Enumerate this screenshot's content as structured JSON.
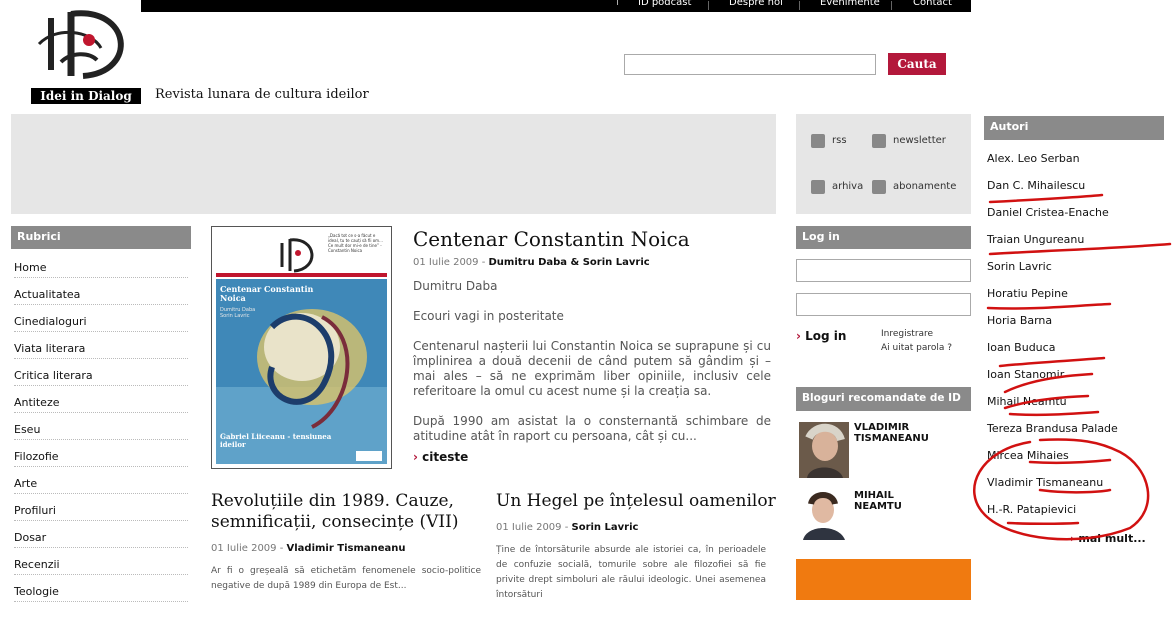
{
  "topnav": [
    "ID podcast",
    "Despre noi",
    "Evenimente",
    "Contact"
  ],
  "logo_text": "Idei in Dialog",
  "tagline": "Revista lunara de cultura ideilor",
  "search": {
    "button": "Cauta"
  },
  "rubrici": {
    "title": "Rubrici",
    "items": [
      "Home",
      "Actualitatea",
      "Cinedialoguri",
      "Viata literara",
      "Critica literara",
      "Antiteze",
      "Eseu",
      "Filozofie",
      "Arte",
      "Profiluri",
      "Dosar",
      "Recenzii",
      "Teologie"
    ]
  },
  "cover": {
    "quote": "„Dacă tot ce s-a făcut e ideal, tu te cauți să fii om... Ce mult dor mi-e de tine” - Constantin Noica",
    "title": "Centenar Constantin Noica",
    "authors": "Dumitru Daba\nSorin Lavric",
    "bottom": "Gabriel Liiceanu - tensiunea ideilor"
  },
  "main_article": {
    "title": "Centenar Constantin Noica",
    "date": "01 Iulie 2009 - ",
    "author": "Dumitru Daba & Sorin Lavric",
    "p1": "Dumitru Daba",
    "p2": "Ecouri vagi in posteritate",
    "p3": "Centenarul nașterii lui Constantin Noica se suprapune și cu împlinirea a două decenii de când putem să gândim și – mai ales – să ne exprimăm liber opiniile, inclusiv cele referitoare la omul cu acest nume și la creația sa.",
    "p4": "După 1990 am asistat la o consternantă schimbare de atitudine atât în raport cu persoana, cât și cu...",
    "more": "citeste"
  },
  "article2": {
    "title": "Revoluțiile din 1989. Cauze, semnificații, consecințe (VII)",
    "date": "01 Iulie 2009 - ",
    "author": "Vladimir Tismaneanu",
    "text": "Ar fi o greșeală să etichetăm fenomenele socio-politice negative de după 1989 din Europa de Est..."
  },
  "article3": {
    "title": "Un Hegel pe înțelesul oamenilor",
    "date": "01 Iulie 2009 - ",
    "author": "Sorin Lavric",
    "text": "Ține de întorsăturile absurde ale istoriei ca, în perioadele de confuzie socială, tomurile sobre ale filozofiei să fie privite drept simboluri ale răului ideologic. Unei asemenea întorsături"
  },
  "links": {
    "rss": "rss",
    "newsletter": "newsletter",
    "arhiva": "arhiva",
    "abonamente": "abonamente"
  },
  "login": {
    "title": "Log in",
    "button": "Log in",
    "register": "Inregistrare",
    "forgot": "Ai uitat parola ?"
  },
  "blogs": {
    "title": "Bloguri recomandate de ID",
    "items": [
      {
        "name": "VLADIMIR\nTISMANEANU"
      },
      {
        "name": "MIHAIL\nNEAMTU"
      }
    ]
  },
  "autori": {
    "title": "Autori",
    "items": [
      "Alex. Leo Serban",
      "Dan C. Mihailescu",
      "Daniel Cristea-Enache",
      "Traian Ungureanu",
      "Sorin Lavric",
      "Horatiu Pepine",
      "Horia Barna",
      "Ioan Buduca",
      "Ioan Stanomir",
      "Mihail Neamtu",
      "Tereza Brandusa Palade",
      "Mircea Mihaies",
      "Vladimir Tismaneanu",
      "H.-R. Patapievici"
    ],
    "more": "mai mult..."
  },
  "colors": {
    "accent": "#b3183b",
    "header_gray": "#8a8a8a",
    "banner": "#e6e6e6",
    "orange": "#f07a10",
    "annotation_red": "#d11111"
  }
}
